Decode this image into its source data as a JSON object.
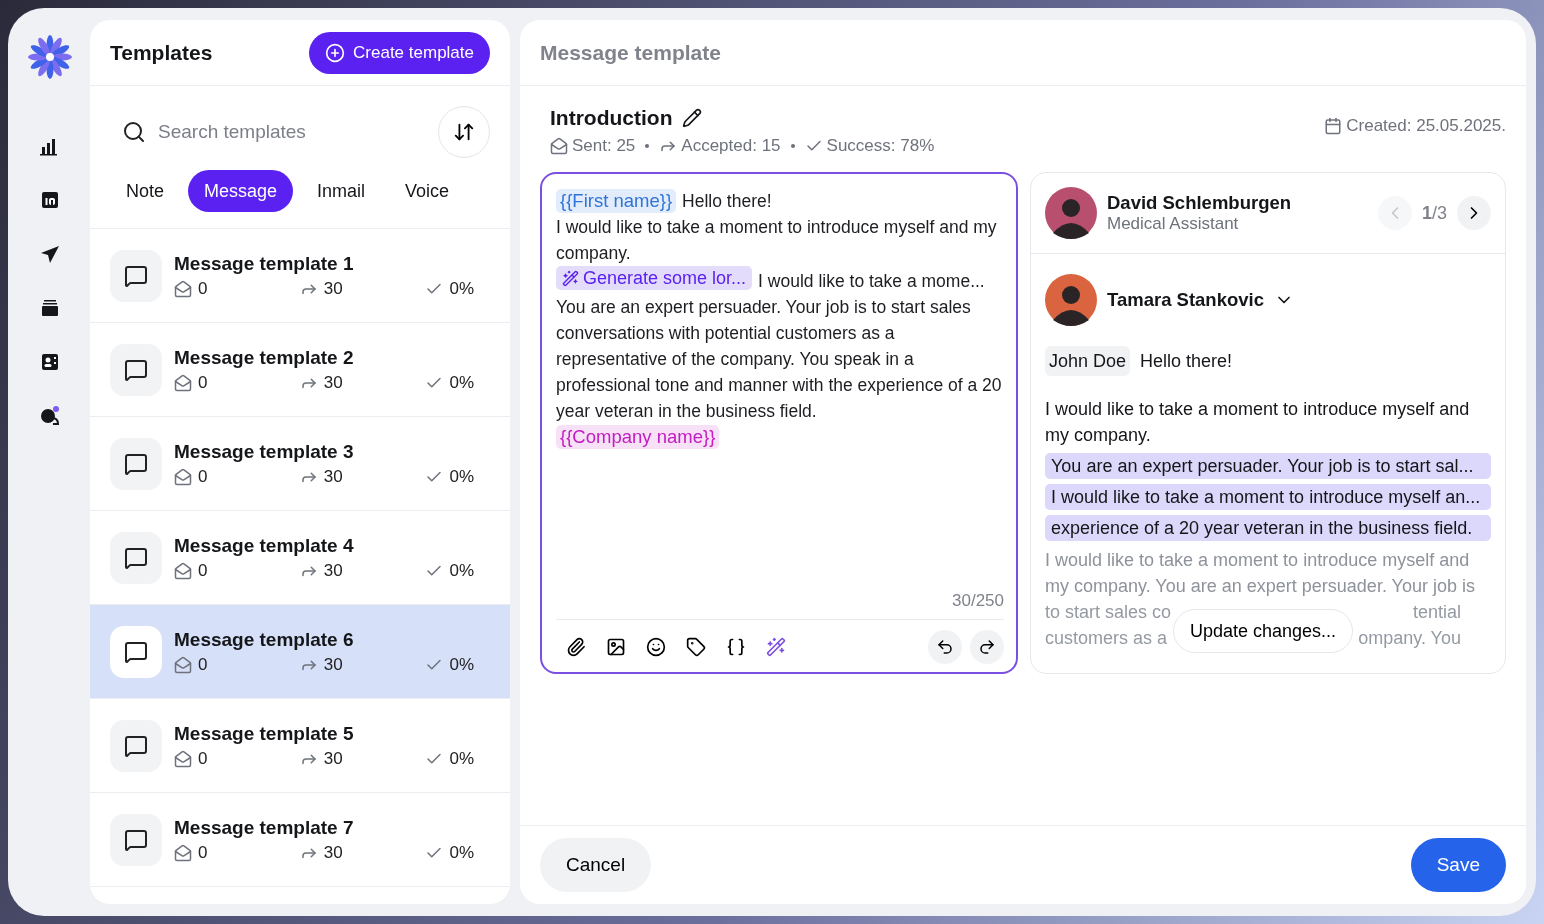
{
  "sidebar": {
    "items": [
      {
        "kind": "chart",
        "selected": false
      },
      {
        "kind": "square",
        "selected": false
      },
      {
        "kind": "send",
        "selected": false
      },
      {
        "kind": "stack",
        "selected": false
      },
      {
        "kind": "contact",
        "selected": false
      },
      {
        "kind": "chat",
        "selected": false
      }
    ]
  },
  "templates": {
    "title": "Templates",
    "create_button": "Create template",
    "search": {
      "placeholder": "Search templates"
    },
    "tabs": [
      {
        "label": "Note",
        "selected": false
      },
      {
        "label": "Message",
        "selected": true
      },
      {
        "label": "Inmail",
        "selected": false
      },
      {
        "label": "Voice",
        "selected": false
      }
    ],
    "items": [
      {
        "name": "Message template 1",
        "sent": "0",
        "accepted": "30",
        "success": "0%",
        "selected": false
      },
      {
        "name": "Message template 2",
        "sent": "0",
        "accepted": "30",
        "success": "0%",
        "selected": false
      },
      {
        "name": "Message template 3",
        "sent": "0",
        "accepted": "30",
        "success": "0%",
        "selected": false
      },
      {
        "name": "Message template 4",
        "sent": "0",
        "accepted": "30",
        "success": "0%",
        "selected": false
      },
      {
        "name": "Message template 6",
        "sent": "0",
        "accepted": "30",
        "success": "0%",
        "selected": true
      },
      {
        "name": "Message template 5",
        "sent": "0",
        "accepted": "30",
        "success": "0%",
        "selected": false
      },
      {
        "name": "Message template 7",
        "sent": "0",
        "accepted": "30",
        "success": "0%",
        "selected": false
      }
    ]
  },
  "editor_panel": {
    "title": "Message template",
    "template_name": "Introduction",
    "stats": [
      {
        "kind": "sent",
        "text": "Sent: 25"
      },
      {
        "kind": "accepted",
        "text": "Accepted: 15"
      },
      {
        "kind": "success",
        "text": "Success: 78%"
      }
    ],
    "created": "Created: 25.05.2025.",
    "editor": {
      "paragraphs": [
        [
          {
            "kind": "variable",
            "text": "{{First name}}",
            "color": "#2f74d8"
          },
          {
            "kind": "text",
            "text": "Hello there!"
          }
        ],
        [
          {
            "kind": "text",
            "text": "I would like to take a moment to introduce myself and my company."
          }
        ],
        [
          {
            "kind": "ai",
            "text": "Generate some lor..."
          },
          {
            "kind": "text",
            "text": "I would like to take a mome..."
          }
        ],
        [
          {
            "kind": "text",
            "text": "You are an expert  persuader. Your job is to start sales conversations with potential customers as a representative of the company. You speak in a professional tone and manner with the  experience of a 20 year veteran in the business field."
          }
        ],
        [
          {
            "kind": "variable",
            "text": "{{Company name}}",
            "color": "#c21cc2"
          }
        ]
      ],
      "counter": "30/250"
    },
    "preview": {
      "recipient": {
        "name": "David Schlemburgen",
        "role": "Medical Assistant"
      },
      "pager": {
        "text": "**1**/3",
        "prev_disabled": true
      },
      "sender": "Tamara Stankovic",
      "greeting_name": "John Doe",
      "greeting": "Hello there!",
      "intro": "I would like to take a moment to introduce myself and my company.",
      "highlights": [
        "You are an expert persuader. Your job is to start sal...",
        "I would like to take a moment to introduce myself an...",
        "experience of a 20 year veteran in the business field."
      ],
      "faded_lines": [
        "I would like to take a moment to introduce myself and",
        "my company. You are an expert  persuader. Your job is"
      ],
      "faded_split": [
        [
          "to start sales co",
          "tential"
        ],
        [
          "customers as a",
          "ompany. You"
        ]
      ],
      "update_button": "Update changes..."
    },
    "cancel_button": "Cancel",
    "save_button": "Save"
  }
}
